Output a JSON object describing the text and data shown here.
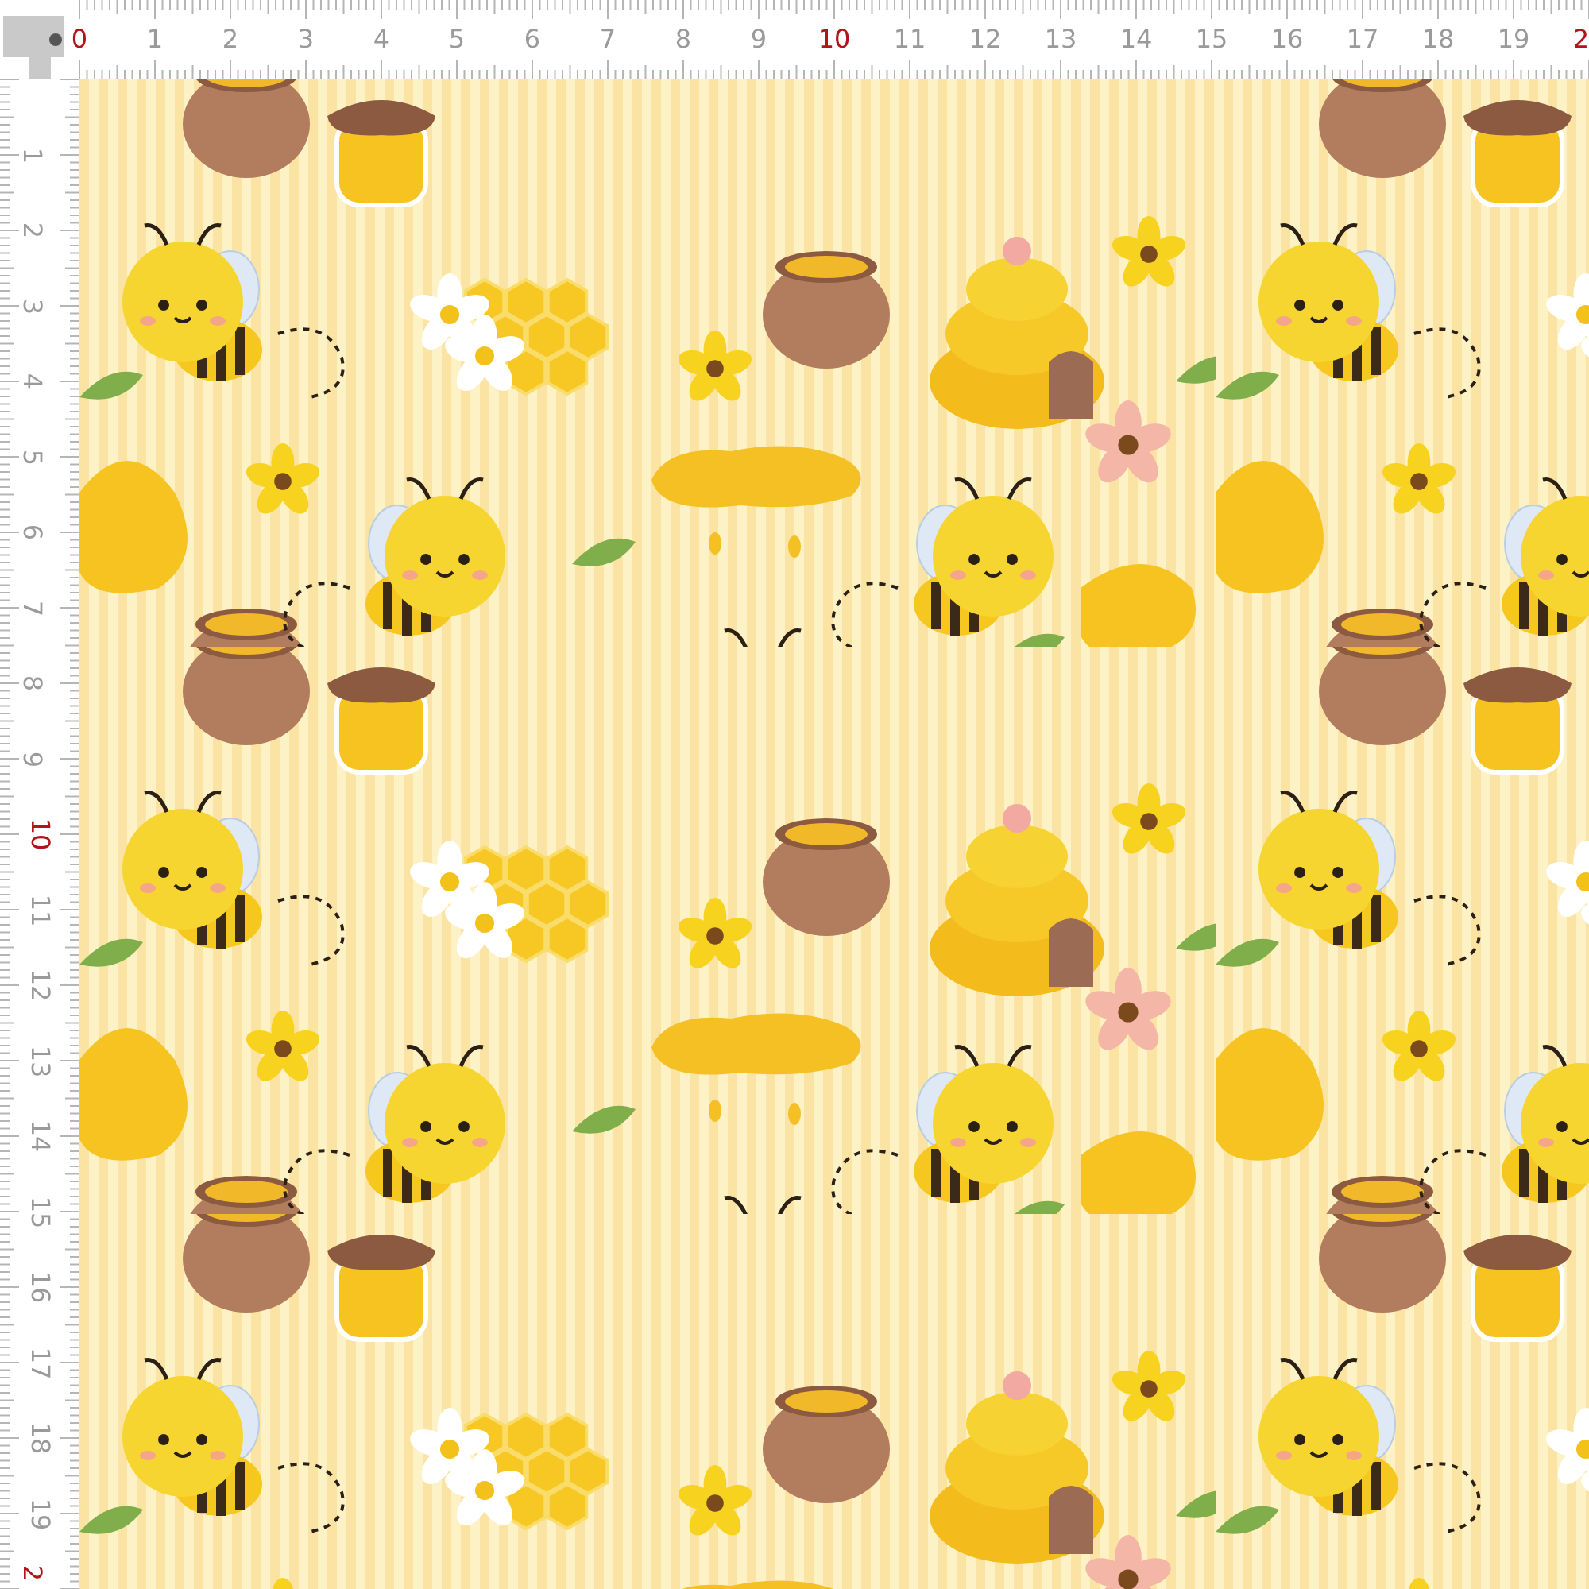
{
  "rulers": {
    "top": {
      "labels": [
        {
          "text": "0",
          "color": "#b3141a"
        },
        {
          "text": "1",
          "color": "#9a9a9a"
        },
        {
          "text": "2",
          "color": "#9a9a9a"
        },
        {
          "text": "3",
          "color": "#9a9a9a"
        },
        {
          "text": "4",
          "color": "#9a9a9a"
        },
        {
          "text": "5",
          "color": "#9a9a9a"
        },
        {
          "text": "6",
          "color": "#9a9a9a"
        },
        {
          "text": "7",
          "color": "#9a9a9a"
        },
        {
          "text": "8",
          "color": "#9a9a9a"
        },
        {
          "text": "9",
          "color": "#9a9a9a"
        },
        {
          "text": "10",
          "color": "#b3141a"
        },
        {
          "text": "11",
          "color": "#9a9a9a"
        },
        {
          "text": "12",
          "color": "#9a9a9a"
        },
        {
          "text": "13",
          "color": "#9a9a9a"
        },
        {
          "text": "14",
          "color": "#9a9a9a"
        },
        {
          "text": "15",
          "color": "#9a9a9a"
        },
        {
          "text": "16",
          "color": "#9a9a9a"
        },
        {
          "text": "17",
          "color": "#9a9a9a"
        },
        {
          "text": "18",
          "color": "#9a9a9a"
        },
        {
          "text": "19",
          "color": "#9a9a9a"
        },
        {
          "text": "2",
          "color": "#b3141a"
        }
      ]
    },
    "left": {
      "labels": [
        {
          "text": "1",
          "color": "#9a9a9a"
        },
        {
          "text": "2",
          "color": "#9a9a9a"
        },
        {
          "text": "3",
          "color": "#9a9a9a"
        },
        {
          "text": "4",
          "color": "#9a9a9a"
        },
        {
          "text": "5",
          "color": "#9a9a9a"
        },
        {
          "text": "6",
          "color": "#9a9a9a"
        },
        {
          "text": "7",
          "color": "#9a9a9a"
        },
        {
          "text": "8",
          "color": "#9a9a9a"
        },
        {
          "text": "9",
          "color": "#9a9a9a"
        },
        {
          "text": "10",
          "color": "#b3141a"
        },
        {
          "text": "11",
          "color": "#9a9a9a"
        },
        {
          "text": "12",
          "color": "#9a9a9a"
        },
        {
          "text": "13",
          "color": "#9a9a9a"
        },
        {
          "text": "14",
          "color": "#9a9a9a"
        },
        {
          "text": "15",
          "color": "#9a9a9a"
        },
        {
          "text": "16",
          "color": "#9a9a9a"
        },
        {
          "text": "17",
          "color": "#9a9a9a"
        },
        {
          "text": "18",
          "color": "#9a9a9a"
        },
        {
          "text": "19",
          "color": "#9a9a9a"
        },
        {
          "text": "2",
          "color": "#b3141a"
        }
      ]
    }
  }
}
